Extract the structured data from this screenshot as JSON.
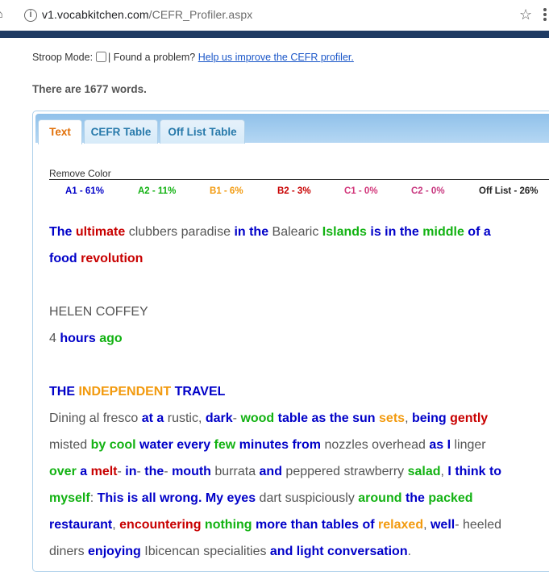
{
  "browser": {
    "url_host": "v1.vocabkitchen.com",
    "url_path": "/CEFR_Profiler.aspx"
  },
  "stroop": {
    "label": "Stroop Mode:",
    "problem_text": "| Found a problem?",
    "help_link": "Help us improve the CEFR profiler."
  },
  "word_count_text": "There are 1677 words.",
  "tabs": [
    {
      "label": "Text",
      "active": true
    },
    {
      "label": "CEFR Table",
      "active": false
    },
    {
      "label": "Off List Table",
      "active": false
    }
  ],
  "legend": {
    "remove_color": "Remove Color",
    "items": [
      {
        "label": "A1 - 61%",
        "color": "#0000c8"
      },
      {
        "label": "A2 - 11%",
        "color": "#12b212"
      },
      {
        "label": "B1 - 6%",
        "color": "#f29a0e"
      },
      {
        "label": "B2 - 3%",
        "color": "#c80000"
      },
      {
        "label": "C1 - 0%",
        "color": "#d2367a"
      },
      {
        "label": "C2 - 0%",
        "color": "#c8377f"
      },
      {
        "label": "Off List - 26%",
        "color": "#222222"
      }
    ]
  },
  "text_lines": [
    [
      [
        "a1",
        "The "
      ],
      [
        "b2",
        "ultimate "
      ],
      [
        "off",
        "clubbers paradise "
      ],
      [
        "a1",
        "in the "
      ],
      [
        "off",
        "Balearic "
      ],
      [
        "a2",
        "Islands "
      ],
      [
        "a1",
        "is in the "
      ],
      [
        "a2",
        "middle "
      ],
      [
        "a1",
        "of a"
      ]
    ],
    [
      [
        "a1",
        "food "
      ],
      [
        "b2",
        "revolution"
      ]
    ],
    [
      [
        "off",
        "HELEN COFFEY"
      ]
    ],
    [
      [
        "off",
        "4 "
      ],
      [
        "a1",
        "hours "
      ],
      [
        "a2",
        "ago"
      ]
    ],
    [
      [
        "a1",
        "THE "
      ],
      [
        "b1",
        "INDEPENDENT "
      ],
      [
        "a1",
        "TRAVEL"
      ]
    ],
    [
      [
        "off",
        "Dining al fresco "
      ],
      [
        "a1",
        "at a "
      ],
      [
        "off",
        "rustic, "
      ],
      [
        "a1",
        "dark"
      ],
      [
        "off",
        "- "
      ],
      [
        "a2",
        "wood "
      ],
      [
        "a1",
        "table as the sun "
      ],
      [
        "b1",
        "sets"
      ],
      [
        "off",
        ", "
      ],
      [
        "a1",
        "being "
      ],
      [
        "b2",
        "gently"
      ]
    ],
    [
      [
        "off",
        "misted "
      ],
      [
        "a2",
        "by cool "
      ],
      [
        "a1",
        "water every "
      ],
      [
        "a2",
        "few "
      ],
      [
        "a1",
        "minutes from "
      ],
      [
        "off",
        "nozzles overhead "
      ],
      [
        "a1",
        "as I "
      ],
      [
        "off",
        "linger"
      ]
    ],
    [
      [
        "a2",
        "over "
      ],
      [
        "a1",
        "a "
      ],
      [
        "b2",
        "melt"
      ],
      [
        "off",
        "- "
      ],
      [
        "a1",
        "in"
      ],
      [
        "off",
        "- "
      ],
      [
        "a1",
        "the"
      ],
      [
        "off",
        "- "
      ],
      [
        "a1",
        "mouth "
      ],
      [
        "off",
        "burrata "
      ],
      [
        "a1",
        "and "
      ],
      [
        "off",
        "peppered strawberry "
      ],
      [
        "a2",
        "salad"
      ],
      [
        "off",
        ", "
      ],
      [
        "a1",
        "I think to"
      ]
    ],
    [
      [
        "a2",
        "myself"
      ],
      [
        "off",
        ": "
      ],
      [
        "a1",
        "This is all wrong. My eyes "
      ],
      [
        "off",
        "dart suspiciously "
      ],
      [
        "a2",
        "around "
      ],
      [
        "a1",
        "the "
      ],
      [
        "a2",
        "packed"
      ]
    ],
    [
      [
        "a1",
        "restaurant"
      ],
      [
        "off",
        ", "
      ],
      [
        "b2",
        "encountering "
      ],
      [
        "a2",
        "nothing "
      ],
      [
        "a1",
        "more than tables of "
      ],
      [
        "b1",
        "relaxed"
      ],
      [
        "off",
        ", "
      ],
      [
        "a1",
        "well"
      ],
      [
        "off",
        "- heeled"
      ]
    ],
    [
      [
        "off",
        "diners "
      ],
      [
        "a1",
        "enjoying "
      ],
      [
        "off",
        "Ibicencan specialities "
      ],
      [
        "a1",
        "and light conversation"
      ],
      [
        "off",
        "."
      ]
    ]
  ]
}
